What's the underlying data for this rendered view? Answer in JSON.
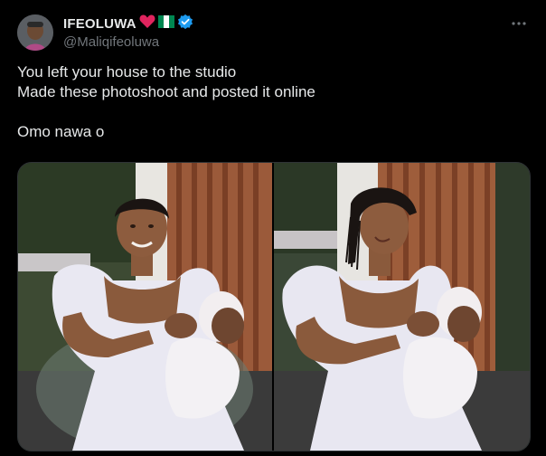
{
  "author": {
    "display_name": "IFEOLUWA",
    "handle": "@Maliqifeoluwa",
    "verified": true,
    "name_emojis": [
      "red-heart-icon",
      "nigeria-flag-icon"
    ]
  },
  "post": {
    "lines": [
      "You left your house to the studio",
      "Made these photoshoot and posted it online",
      "",
      "Omo nawa o"
    ]
  },
  "media": {
    "count": 2
  },
  "colors": {
    "background": "#000000",
    "text": "#e7e9ea",
    "muted": "#71767b",
    "verified": "#1d9bf0",
    "border": "#2f3336"
  }
}
